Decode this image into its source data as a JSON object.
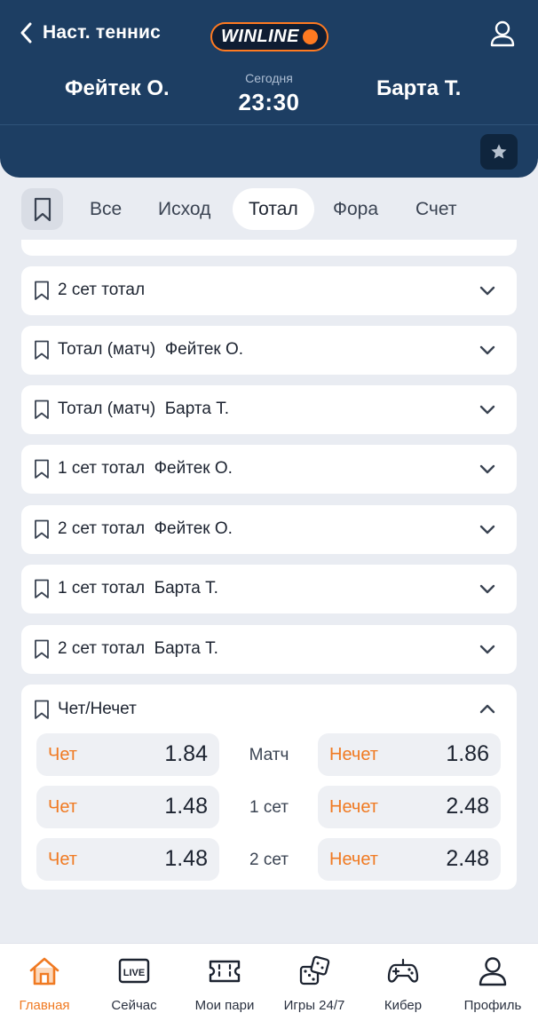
{
  "header": {
    "back_label": "Наст. теннис",
    "logo_text": "WINLINE",
    "home_team": "Фейтек О.",
    "away_team": "Барта Т.",
    "date_label": "Сегодня",
    "time": "23:30",
    "icons": {
      "back": "chevron-left-icon",
      "user": "user-icon",
      "favorite": "star-icon"
    }
  },
  "tabs": [
    {
      "label": "Все",
      "active": false
    },
    {
      "label": "Исход",
      "active": false
    },
    {
      "label": "Тотал",
      "active": true
    },
    {
      "label": "Фора",
      "active": false
    },
    {
      "label": "Счет",
      "active": false
    }
  ],
  "markets": [
    {
      "title": "2 сет тотал"
    },
    {
      "title": "Тотал (матч)  Фейтек О."
    },
    {
      "title": "Тотал (матч)  Барта Т."
    },
    {
      "title": "1 сет тотал  Фейтек О."
    },
    {
      "title": "2 сет тотал  Фейтек О."
    },
    {
      "title": "1 сет тотал  Барта Т."
    },
    {
      "title": "2 сет тотал  Барта Т."
    }
  ],
  "expanded_market": {
    "title": "Чет/Нечет",
    "rows": [
      {
        "left_label": "Чет",
        "left_value": "1.84",
        "period": "Матч",
        "right_label": "Нечет",
        "right_value": "1.86"
      },
      {
        "left_label": "Чет",
        "left_value": "1.48",
        "period": "1 сет",
        "right_label": "Нечет",
        "right_value": "2.48"
      },
      {
        "left_label": "Чет",
        "left_value": "1.48",
        "period": "2 сет",
        "right_label": "Нечет",
        "right_value": "2.48"
      }
    ]
  },
  "nav": [
    {
      "label": "Главная",
      "icon": "home-icon",
      "active": true
    },
    {
      "label": "Сейчас",
      "icon": "live-icon",
      "active": false
    },
    {
      "label": "Мои пари",
      "icon": "ticket-icon",
      "active": false
    },
    {
      "label": "Игры 24/7",
      "icon": "dice-icon",
      "active": false
    },
    {
      "label": "Кибер",
      "icon": "gamepad-icon",
      "active": false
    },
    {
      "label": "Профиль",
      "icon": "profile-icon",
      "active": false
    }
  ],
  "nav_icon_text": {
    "live": "LIVE"
  },
  "colors": {
    "header_bg": "#1d3e63",
    "accent": "#f07a22",
    "background": "#e9ecf2"
  }
}
